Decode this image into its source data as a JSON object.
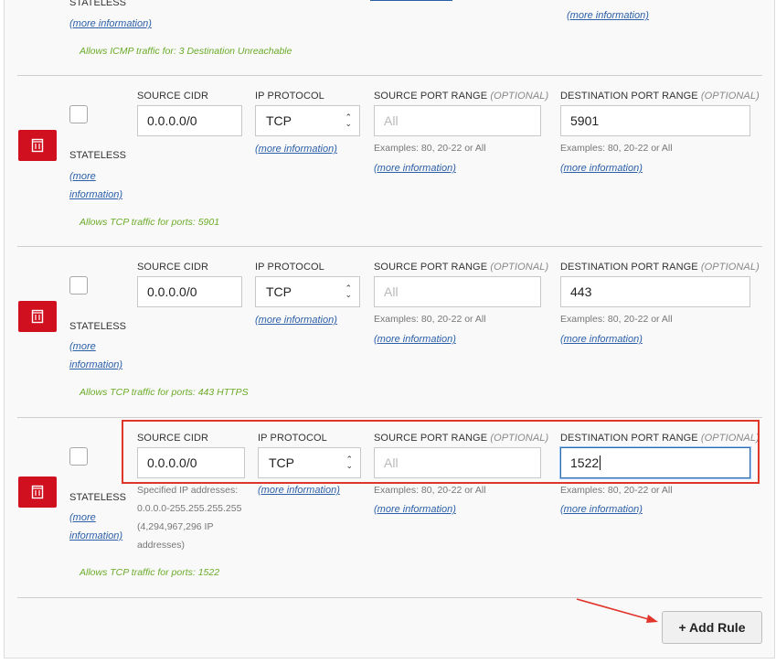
{
  "top_partial": {
    "stateless_label": "STATELESS",
    "more_info": "(more information)",
    "allows": "Allows ICMP traffic for: 3 Destination Unreachable"
  },
  "common": {
    "source_cidr_label": "SOURCE CIDR",
    "ip_protocol_label": "IP PROTOCOL",
    "source_port_label": "SOURCE PORT RANGE",
    "dest_port_label": "DESTINATION PORT RANGE",
    "optional": "(OPTIONAL)",
    "port_placeholder": "All",
    "port_examples": "Examples: 80, 20-22 or All",
    "more_info": "(more information)",
    "more": "(more",
    "information": "information)",
    "stateless": "STATELESS"
  },
  "rules": [
    {
      "source_cidr": "0.0.0.0/0",
      "protocol": "TCP",
      "dest_port": "5901",
      "allows": "Allows TCP traffic for ports: 5901"
    },
    {
      "source_cidr": "0.0.0.0/0",
      "protocol": "TCP",
      "dest_port": "443",
      "allows": "Allows TCP traffic for ports: 443 HTTPS"
    },
    {
      "source_cidr": "0.0.0.0/0",
      "protocol": "TCP",
      "dest_port": "1522",
      "allows": "Allows TCP traffic for ports: 1522",
      "cidr_hint_1": "Specified IP addresses:",
      "cidr_hint_2": "0.0.0.0-255.255.255.255",
      "cidr_hint_3": "(4,294,967,296 IP",
      "cidr_hint_4": "addresses)"
    }
  ],
  "add_rule_label": "+ Add Rule",
  "colors": {
    "delete_button": "#d0101e",
    "highlight": "#e0352b",
    "allows_text": "#6aab28",
    "link": "#2b5fa8"
  },
  "icons": {
    "delete": "trash-icon"
  }
}
